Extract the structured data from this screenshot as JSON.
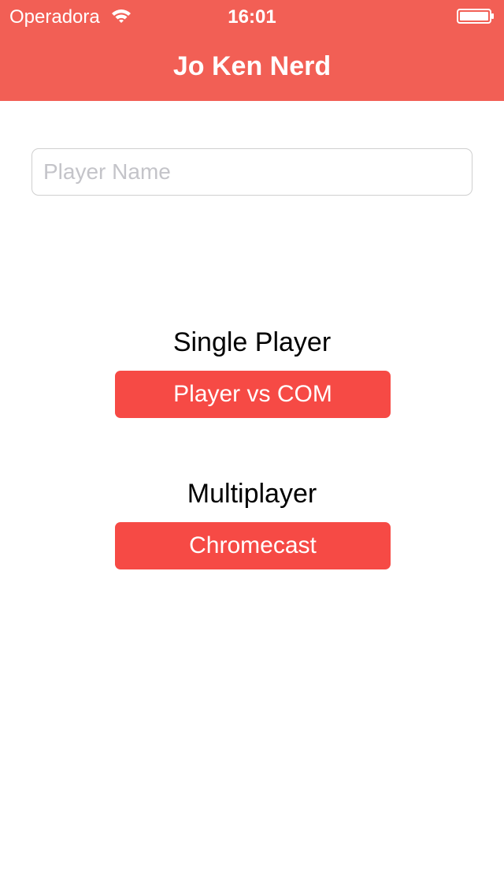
{
  "status_bar": {
    "carrier": "Operadora",
    "time": "16:01",
    "icons": [
      "wifi-icon",
      "battery-icon"
    ]
  },
  "nav": {
    "title": "Jo Ken Nerd"
  },
  "player_name": {
    "value": "",
    "placeholder": "Player Name"
  },
  "single_player": {
    "label": "Single Player",
    "button_label": "Player vs COM"
  },
  "multiplayer": {
    "label": "Multiplayer",
    "button_label": "Chromecast"
  },
  "colors": {
    "header_background": "#f25f55",
    "button_background": "#f64a45",
    "text_on_accent": "#ffffff",
    "placeholder": "#c4c4c9"
  }
}
